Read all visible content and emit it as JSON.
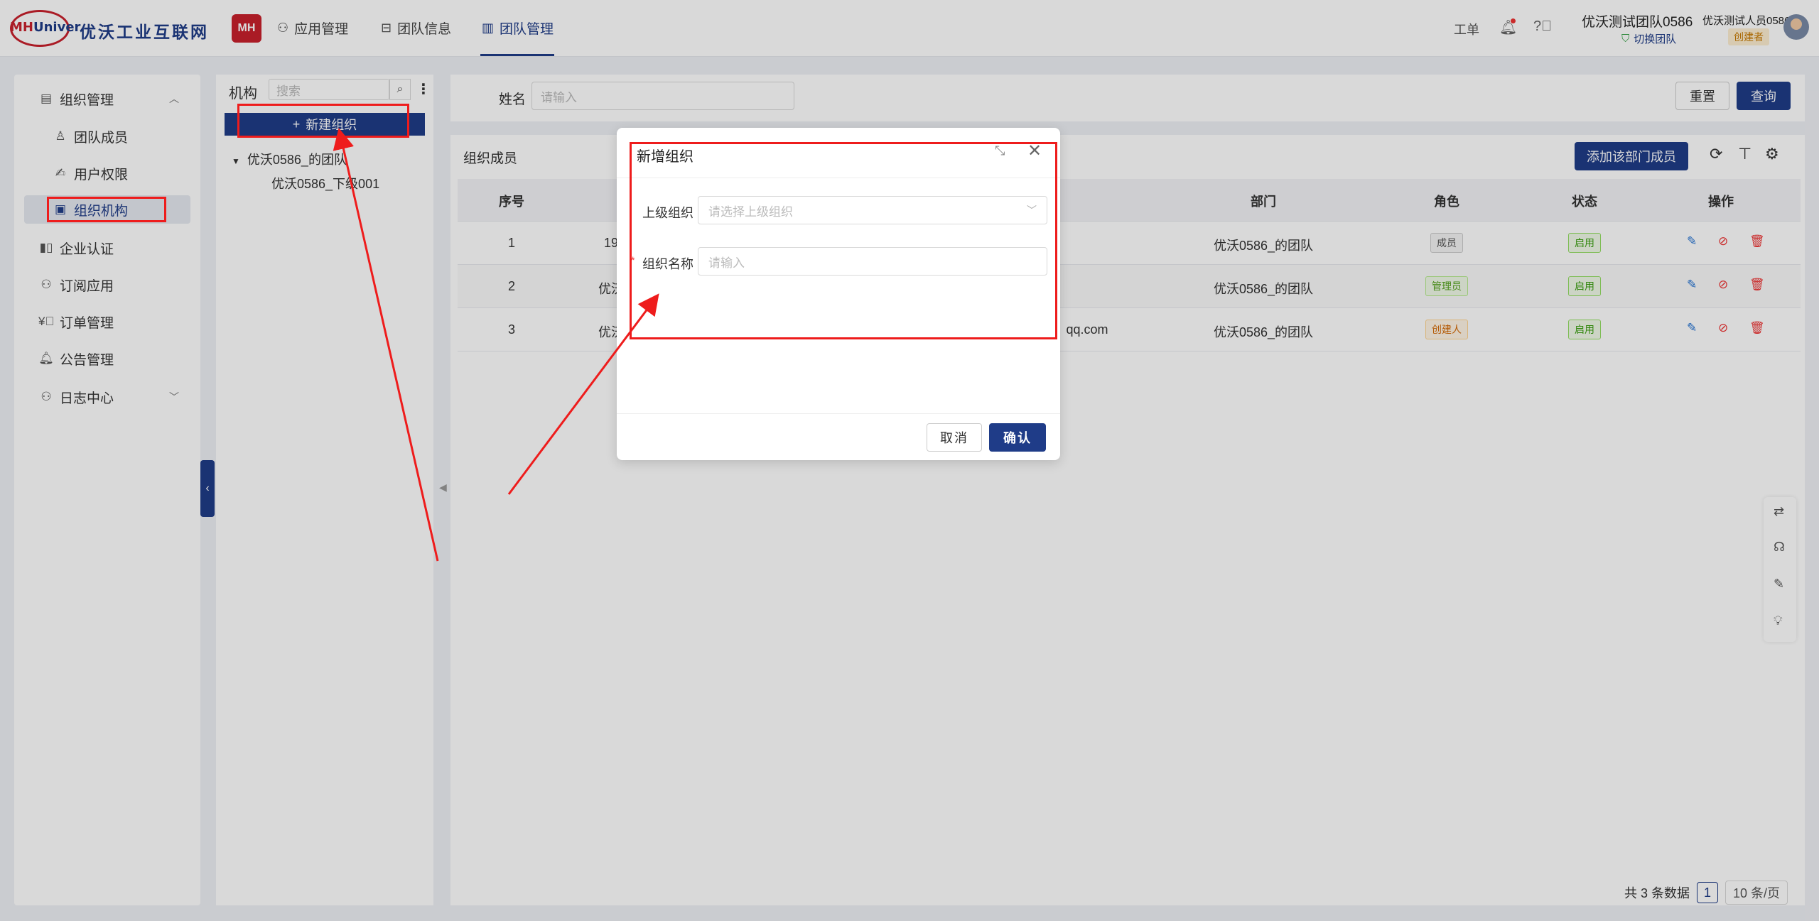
{
  "header": {
    "logo_text_red": "MH",
    "logo_text_blue": "Univer",
    "brand": "优沃工业互联网",
    "badge": "MH",
    "nav": [
      {
        "label": "应用管理",
        "icon": "apps-icon"
      },
      {
        "label": "团队信息",
        "icon": "layout-icon"
      },
      {
        "label": "团队管理",
        "icon": "building-icon",
        "active": true
      }
    ],
    "ticket": "工单",
    "team_name": "优沃测试团队0586",
    "switch_team": "切换团队",
    "user_name": "优沃测试人员0586",
    "creator_badge": "创建者"
  },
  "sidebar": {
    "items": [
      {
        "label": "组织管理",
        "icon": "org-manage-icon",
        "expanded": true
      },
      {
        "label": "团队成员",
        "icon": "user-icon"
      },
      {
        "label": "用户权限",
        "icon": "permission-icon"
      },
      {
        "label": "组织机构",
        "icon": "org-structure-icon",
        "active": true
      },
      {
        "label": "企业认证",
        "icon": "chart-icon"
      },
      {
        "label": "订阅应用",
        "icon": "subscribe-icon"
      },
      {
        "label": "订单管理",
        "icon": "order-icon"
      },
      {
        "label": "公告管理",
        "icon": "notice-icon"
      },
      {
        "label": "日志中心",
        "icon": "log-icon",
        "expandable": true
      }
    ]
  },
  "tree": {
    "label": "机构",
    "search_placeholder": "搜索",
    "new_org_button": "新建组织",
    "nodes": [
      "优沃0586_的团队",
      "优沃0586_下级001"
    ]
  },
  "filter": {
    "name_label": "姓名",
    "name_placeholder": "请输入",
    "reset": "重置",
    "query": "查询"
  },
  "table": {
    "title": "组织成员",
    "add_button": "添加该部门成员",
    "columns": [
      "序号",
      "部门",
      "角色",
      "状态",
      "操作"
    ],
    "rows": [
      {
        "index": "1",
        "col2": "19",
        "col3": "",
        "dept": "优沃0586_的团队",
        "role": "成员",
        "role_type": "member",
        "status": "启用"
      },
      {
        "index": "2",
        "col2": "优沃",
        "col3": "",
        "dept": "优沃0586_的团队",
        "role": "管理员",
        "role_type": "admin",
        "status": "启用"
      },
      {
        "index": "3",
        "col2": "优沃",
        "col3": "qq.com",
        "dept": "优沃0586_的团队",
        "role": "创建人",
        "role_type": "creator",
        "status": "启用"
      }
    ]
  },
  "pagination": {
    "total": "共 3 条数据",
    "page": "1",
    "page_size": "10 条/页"
  },
  "modal": {
    "title": "新增组织",
    "parent_label": "上级组织",
    "parent_placeholder": "请选择上级组织",
    "name_label": "组织名称",
    "name_required": "*",
    "name_placeholder": "请输入",
    "cancel": "取消",
    "confirm": "确认"
  },
  "colors": {
    "primary": "#1f3c88",
    "brand_red": "#c8202c",
    "annotation_red": "#ee1c1c"
  }
}
